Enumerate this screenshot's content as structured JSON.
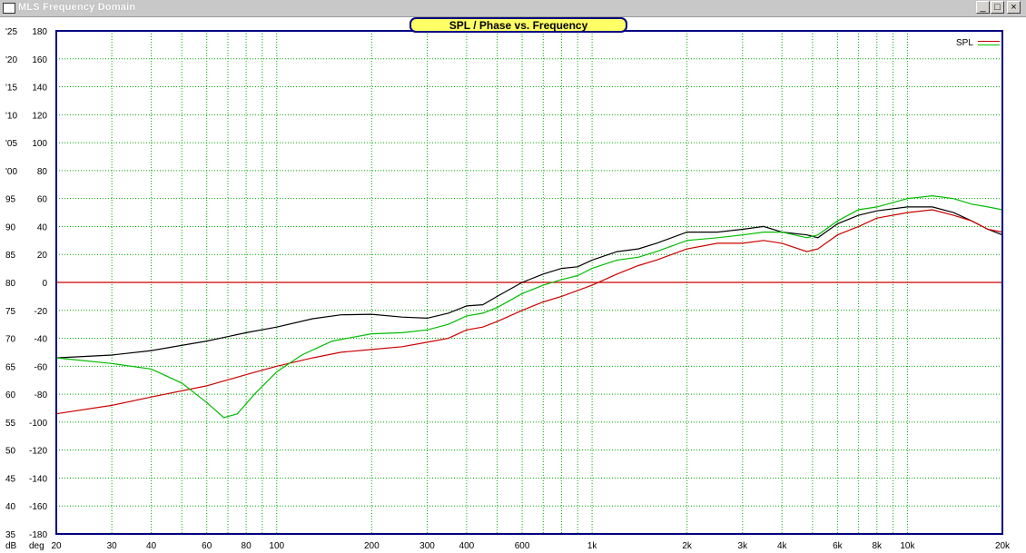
{
  "window": {
    "title": "MLS Frequency Domain",
    "minimize_label": "_",
    "maximize_label": "□",
    "close_label": "×"
  },
  "chart_data": {
    "type": "line",
    "title": "SPL / Phase vs. Frequency",
    "x_scale": "log",
    "xlim": [
      20,
      20000
    ],
    "y_left": {
      "label": "dB",
      "ylim": [
        35,
        125
      ],
      "ticks": [
        125,
        120,
        115,
        110,
        105,
        100,
        95,
        90,
        85,
        80,
        75,
        70,
        65,
        60,
        55,
        50,
        45,
        40,
        35
      ],
      "tick_labels": [
        "'25",
        "'20",
        "'15",
        "'10",
        "'05",
        "'00",
        "95",
        "90",
        "85",
        "80",
        "75",
        "70",
        "65",
        "60",
        "55",
        "50",
        "45",
        "40",
        "35"
      ]
    },
    "y_right": {
      "label": "deg",
      "ylim": [
        -180,
        180
      ],
      "ticks": [
        180,
        160,
        140,
        120,
        100,
        80,
        60,
        40,
        20,
        0,
        -20,
        -40,
        -60,
        -80,
        -100,
        -120,
        -140,
        -160,
        -180
      ],
      "tick_labels": [
        "180",
        "160",
        "140",
        "120",
        "100",
        "80",
        "60",
        "40",
        "20",
        "0",
        "-20",
        "-40",
        "-60",
        "-80",
        "-100",
        "-120",
        "-140",
        "-160",
        "-180"
      ]
    },
    "x_tick_values": [
      20,
      30,
      40,
      60,
      80,
      100,
      200,
      300,
      400,
      600,
      1000,
      2000,
      3000,
      4000,
      6000,
      8000,
      10000,
      20000
    ],
    "x_tick_labels": [
      "20",
      "30",
      "40",
      "60",
      "80",
      "100",
      "200",
      "300",
      "400",
      "600",
      "1k",
      "2k",
      "3k",
      "4k",
      "6k",
      "8k",
      "10k",
      "20k"
    ],
    "grid": true,
    "legend": {
      "position": "top-right",
      "entries": [
        "SPL"
      ]
    },
    "reference_line": {
      "axis": "y_left",
      "value": 80,
      "color": "#cc0000"
    },
    "series": [
      {
        "color": "#000000",
        "points": [
          [
            20,
            66.5
          ],
          [
            30,
            67.0
          ],
          [
            40,
            67.8
          ],
          [
            60,
            69.5
          ],
          [
            80,
            71.0
          ],
          [
            100,
            72.0
          ],
          [
            130,
            73.5
          ],
          [
            160,
            74.2
          ],
          [
            200,
            74.3
          ],
          [
            250,
            73.8
          ],
          [
            300,
            73.6
          ],
          [
            350,
            74.5
          ],
          [
            400,
            75.8
          ],
          [
            450,
            76.0
          ],
          [
            500,
            77.5
          ],
          [
            600,
            80.0
          ],
          [
            700,
            81.5
          ],
          [
            800,
            82.5
          ],
          [
            900,
            82.8
          ],
          [
            1000,
            84.0
          ],
          [
            1200,
            85.5
          ],
          [
            1400,
            86.0
          ],
          [
            1600,
            87.0
          ],
          [
            2000,
            89.0
          ],
          [
            2500,
            89.0
          ],
          [
            3000,
            89.5
          ],
          [
            3500,
            90.0
          ],
          [
            4000,
            89.0
          ],
          [
            4800,
            88.5
          ],
          [
            5200,
            88.0
          ],
          [
            6000,
            90.5
          ],
          [
            7000,
            92.0
          ],
          [
            8000,
            92.8
          ],
          [
            10000,
            93.5
          ],
          [
            12000,
            93.5
          ],
          [
            14000,
            92.5
          ],
          [
            16000,
            91.0
          ],
          [
            18000,
            89.5
          ],
          [
            20000,
            88.5
          ]
        ]
      },
      {
        "color": "#cc0000",
        "points": [
          [
            20,
            56.5
          ],
          [
            30,
            58.0
          ],
          [
            40,
            59.5
          ],
          [
            60,
            61.5
          ],
          [
            80,
            63.5
          ],
          [
            100,
            65.0
          ],
          [
            130,
            66.5
          ],
          [
            160,
            67.5
          ],
          [
            200,
            68.0
          ],
          [
            250,
            68.5
          ],
          [
            300,
            69.3
          ],
          [
            350,
            70.0
          ],
          [
            400,
            71.5
          ],
          [
            450,
            72.0
          ],
          [
            500,
            73.0
          ],
          [
            600,
            75.0
          ],
          [
            700,
            76.5
          ],
          [
            800,
            77.5
          ],
          [
            1000,
            79.5
          ],
          [
            1200,
            81.5
          ],
          [
            1400,
            83.0
          ],
          [
            1600,
            84.0
          ],
          [
            2000,
            86.0
          ],
          [
            2500,
            87.0
          ],
          [
            3000,
            87.0
          ],
          [
            3500,
            87.5
          ],
          [
            4000,
            87.0
          ],
          [
            4800,
            85.5
          ],
          [
            5200,
            86.0
          ],
          [
            6000,
            88.5
          ],
          [
            7000,
            90.0
          ],
          [
            8000,
            91.5
          ],
          [
            10000,
            92.5
          ],
          [
            12000,
            93.0
          ],
          [
            14000,
            92.0
          ],
          [
            16000,
            91.0
          ],
          [
            18000,
            89.5
          ],
          [
            20000,
            89.0
          ]
        ]
      },
      {
        "color": "#00bb00",
        "points": [
          [
            20,
            66.5
          ],
          [
            30,
            65.5
          ],
          [
            40,
            64.5
          ],
          [
            50,
            62.0
          ],
          [
            60,
            58.5
          ],
          [
            68,
            55.8
          ],
          [
            75,
            56.5
          ],
          [
            85,
            60.0
          ],
          [
            100,
            64.0
          ],
          [
            120,
            67.0
          ],
          [
            150,
            69.5
          ],
          [
            200,
            70.8
          ],
          [
            250,
            71.0
          ],
          [
            300,
            71.5
          ],
          [
            350,
            72.5
          ],
          [
            400,
            74.0
          ],
          [
            450,
            74.5
          ],
          [
            500,
            75.5
          ],
          [
            600,
            78.0
          ],
          [
            700,
            79.5
          ],
          [
            800,
            80.5
          ],
          [
            900,
            81.2
          ],
          [
            1000,
            82.5
          ],
          [
            1200,
            84.0
          ],
          [
            1400,
            84.5
          ],
          [
            1600,
            85.5
          ],
          [
            2000,
            87.5
          ],
          [
            2500,
            88.0
          ],
          [
            3000,
            88.5
          ],
          [
            3500,
            89.0
          ],
          [
            4000,
            89.0
          ],
          [
            4800,
            88.0
          ],
          [
            5200,
            88.5
          ],
          [
            6000,
            91.0
          ],
          [
            7000,
            93.0
          ],
          [
            8000,
            93.5
          ],
          [
            10000,
            95.0
          ],
          [
            12000,
            95.5
          ],
          [
            14000,
            95.0
          ],
          [
            16000,
            94.0
          ],
          [
            18000,
            93.5
          ],
          [
            20000,
            93.0
          ]
        ]
      }
    ]
  }
}
